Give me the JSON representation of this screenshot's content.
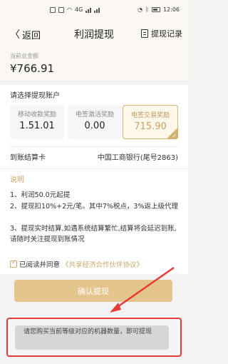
{
  "status_bar": {
    "time": "12:06",
    "network_label": "4G",
    "icons": [
      "sim-icon",
      "wifi-icon",
      "signal-icon",
      "alarm-icon",
      "bluetooth-icon",
      "battery-icon"
    ]
  },
  "nav": {
    "back_label": "返回",
    "title": "利润提现",
    "records_label": "提现记录"
  },
  "total": {
    "label": "当前总金额",
    "value": "¥766.91"
  },
  "account": {
    "heading": "请选择提现账户",
    "options": [
      {
        "label": "移动收款奖励",
        "value": "1.51.01",
        "selected": false
      },
      {
        "label": "电签激活奖励",
        "value": "0.00",
        "selected": false
      },
      {
        "label": "电签交易奖励",
        "value": "715.90",
        "selected": true
      }
    ],
    "card_label": "到账结算卡",
    "card_value": "中国工商银行(尾号2863)"
  },
  "notes": {
    "title": "说明",
    "lines": [
      "1、利润50.0元起提",
      "2、提现扣10%+2元/笔。其中7%税点，3%返上级代理",
      "3、提现实时结算,如遇系统结算繁忙,结算将会延迟到账,请随时关注提现到账情况"
    ]
  },
  "agreement": {
    "checked": true,
    "text": "已阅读并同意",
    "link": "《共享经济合作伙伴协议》"
  },
  "confirm_label": "确认提现",
  "toast": {
    "message": "请您购买当前等级对应的机器数量，即可提现"
  },
  "colors": {
    "gold": "#c9a868",
    "button": "#e4c58d",
    "highlight_red": "#e43b36"
  }
}
